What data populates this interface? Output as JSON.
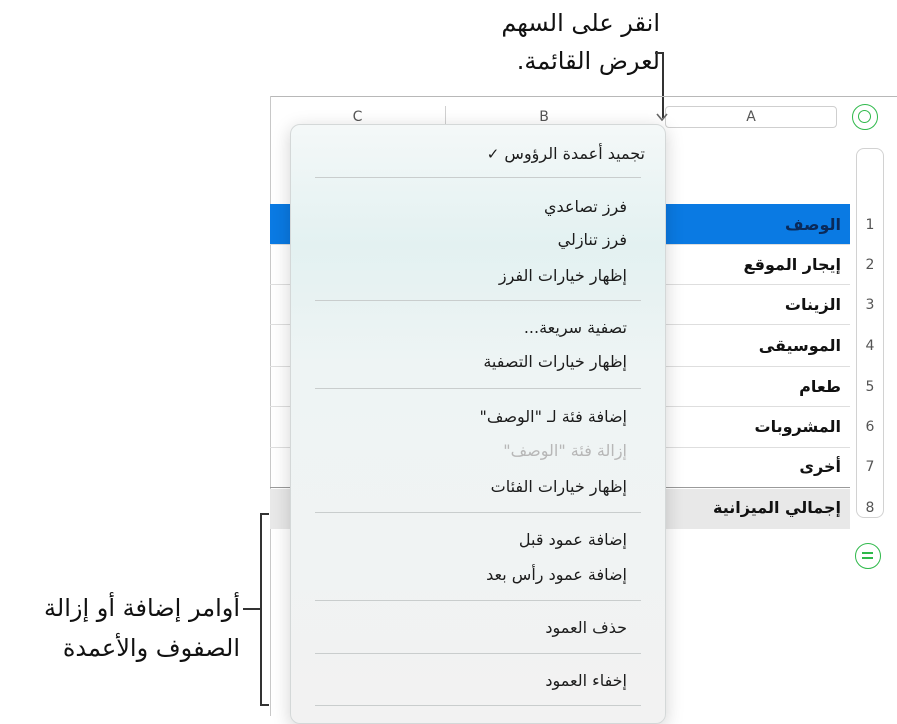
{
  "callouts": {
    "top_line1": "انقر على السهم",
    "top_line2": "لعرض القائمة.",
    "bottom_line1": "أوامر إضافة أو إزالة",
    "bottom_line2": "الصفوف والأعمدة"
  },
  "columns": {
    "c": "C",
    "b": "B",
    "a": "A"
  },
  "rows": [
    {
      "num": "1",
      "label": "الوصف"
    },
    {
      "num": "2",
      "label": "إيجار الموقع"
    },
    {
      "num": "3",
      "label": "الزينات"
    },
    {
      "num": "4",
      "label": "الموسيقى"
    },
    {
      "num": "5",
      "label": "طعام"
    },
    {
      "num": "6",
      "label": "المشروبات"
    },
    {
      "num": "7",
      "label": "أخرى"
    },
    {
      "num": "8",
      "label": "إجمالي الميزانية"
    }
  ],
  "menu": {
    "check": "✓",
    "freeze": "تجميد أعمدة الرؤوس",
    "sort_asc": "فرز تصاعدي",
    "sort_desc": "فرز تنازلي",
    "show_sort": "إظهار خيارات الفرز",
    "quick_filter": "تصفية سريعة...",
    "show_filter": "إظهار خيارات التصفية",
    "add_category": "إضافة فئة لـ \"الوصف\"",
    "remove_category": "إزالة فئة \"الوصف\"",
    "show_categories": "إظهار خيارات الفئات",
    "add_col_before": "إضافة عمود قبل",
    "add_col_after": "إضافة عمود رأس بعد",
    "delete_col": "حذف العمود",
    "hide_col": "إخفاء العمود"
  },
  "colors": {
    "accent": "#0a7ae3",
    "green": "#2fb94b",
    "total_row": "#e8e8e8"
  }
}
